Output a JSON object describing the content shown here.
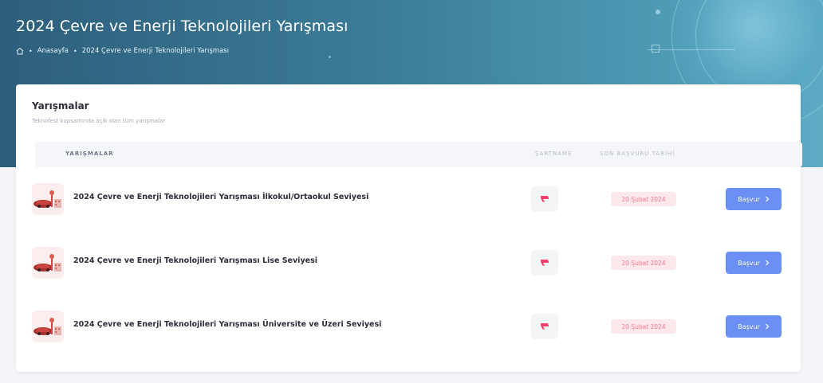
{
  "header": {
    "title": "2024 Çevre ve Enerji Teknolojileri Yarışması",
    "breadcrumb": {
      "home_icon": "home-icon",
      "separator": "•",
      "items": [
        "Anasayfa",
        "2024 Çevre ve Enerji Teknolojileri Yarışması"
      ]
    }
  },
  "card": {
    "title": "Yarışmalar",
    "subtitle": "Teknofest kapsamında açık olan tüm yarışmalar",
    "columns": {
      "main": "YARIŞMALAR",
      "spec": "ŞARTNAME",
      "date": "SON BAŞVURU TARİHİ"
    },
    "rows": [
      {
        "title": "2024 Çevre ve Enerji Teknolojileri Yarışması İlkokul/Ortaokul Seviyesi",
        "deadline": "20 Şubat 2024",
        "apply_label": "Başvur"
      },
      {
        "title": "2024 Çevre ve Enerji Teknolojileri Yarışması Lise Seviyesi",
        "deadline": "20 Şubat 2024",
        "apply_label": "Başvur"
      },
      {
        "title": "2024 Çevre ve Enerji Teknolojileri Yarışması Üniversite ve Üzeri Seviyesi",
        "deadline": "20 Şubat 2024",
        "apply_label": "Başvur"
      }
    ]
  },
  "colors": {
    "header_start": "#2d5f7c",
    "header_end": "#5eacc5",
    "apply_button": "#6c8ff5",
    "date_badge_bg": "#fde8ec",
    "date_badge_text": "#f1798d",
    "pdf_icon": "#f1416c"
  }
}
